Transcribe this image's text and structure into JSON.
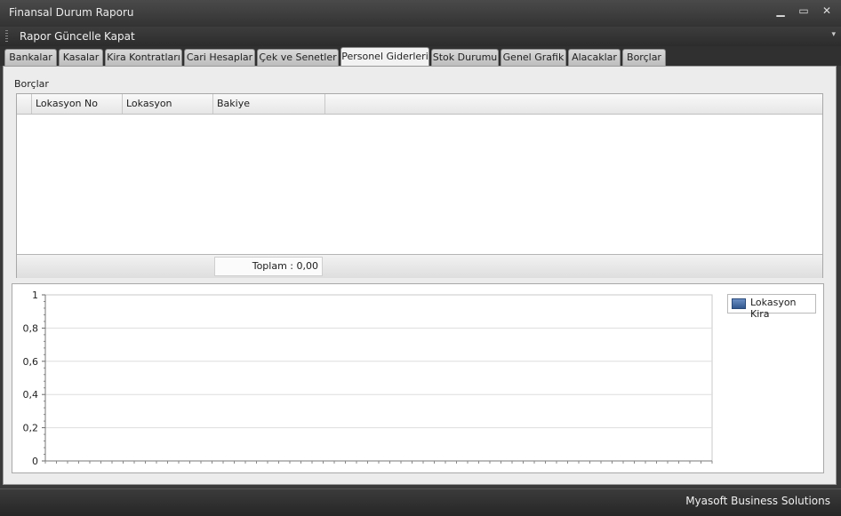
{
  "window": {
    "title": "Finansal Durum Raporu",
    "minimize": "▁",
    "maximize": "▭",
    "close": "✕"
  },
  "menu": {
    "refresh_label": "Rapor Güncelle",
    "close_label": "Kapat",
    "overflow": "▾"
  },
  "tabs": [
    {
      "label": "Bankalar"
    },
    {
      "label": "Kasalar"
    },
    {
      "label": "Kira Kontratları"
    },
    {
      "label": "Cari Hesaplar"
    },
    {
      "label": "Çek ve Senetler"
    },
    {
      "label": "Personel Giderleri"
    },
    {
      "label": "Stok Durumu"
    },
    {
      "label": "Genel Grafik"
    },
    {
      "label": "Alacaklar"
    },
    {
      "label": "Borçlar"
    }
  ],
  "active_tab": "Personel Giderleri",
  "group": {
    "label": "Borçlar"
  },
  "grid": {
    "columns": [
      "Lokasyon No",
      "Lokasyon",
      "Bakiye"
    ],
    "rows": [],
    "total_label": "Toplam : 0,00"
  },
  "chart_data": {
    "type": "bar",
    "categories": [],
    "series": [
      {
        "name": "Lokasyon Kira",
        "values": [],
        "color": "#4a6fa5"
      }
    ],
    "ylim": [
      0,
      1
    ],
    "yticks": [
      "0",
      "0,2",
      "0,4",
      "0,6",
      "0,8",
      "1"
    ],
    "grid": true,
    "legend": "top-right"
  },
  "status": {
    "company": "Myasoft Business Solutions"
  }
}
